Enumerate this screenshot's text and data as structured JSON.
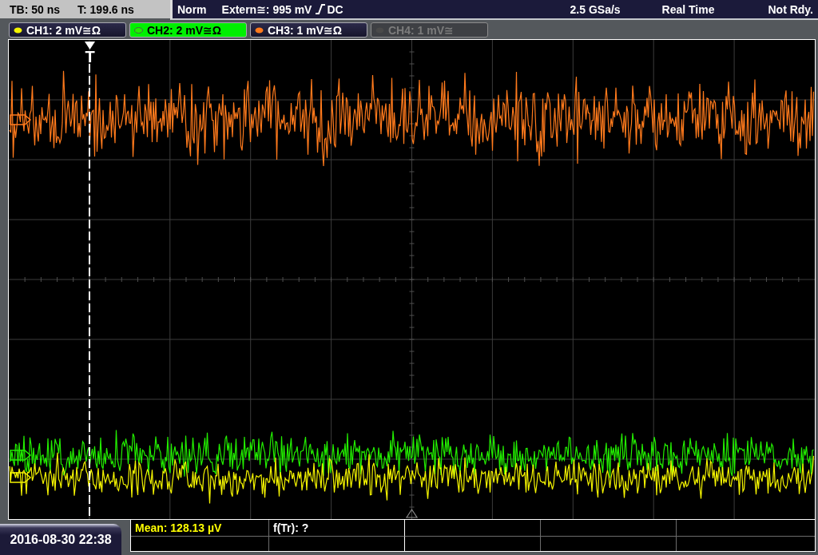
{
  "status_bar": {
    "timebase": "TB: 50 ns",
    "trigger_time": "T: 199.6 ns",
    "trigger_mode": "Norm",
    "trigger_source": "Extern≅: 995 mV",
    "rising_edge": true,
    "trigger_coupling": "DC",
    "sample_rate": "2.5 GSa/s",
    "acquisition_mode": "Real Time",
    "state": "Not Rdy."
  },
  "channels": [
    {
      "label": "CH1: 2 mV≅Ω",
      "color": "#f4f400",
      "selected": false,
      "disabled": false
    },
    {
      "label": "CH2: 2 mV≅Ω",
      "color": "#22ee00",
      "selected": true,
      "disabled": false
    },
    {
      "label": "CH3: 1 mV≅Ω",
      "color": "#ff7a1c",
      "selected": false,
      "disabled": false
    },
    {
      "label": "CH4: 1 mV≅",
      "color": "#4a4a4a",
      "selected": false,
      "disabled": true
    }
  ],
  "plot": {
    "trigger_marker": "T"
  },
  "measurements": [
    {
      "text": "Mean: 128.13 µV",
      "kind": "waveform"
    },
    {
      "text": "f(Tr): ?",
      "kind": "trigger"
    }
  ],
  "date_time": "2016-08-30 22:38"
}
